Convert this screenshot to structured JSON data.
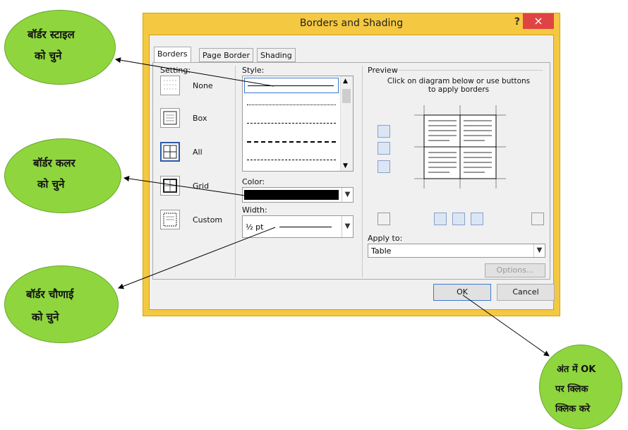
{
  "dialog": {
    "title": "Borders and Shading",
    "help_label": "?",
    "close_label": "×",
    "tabs": [
      {
        "label": "Borders"
      },
      {
        "label": "Page Border"
      },
      {
        "label": "Shading"
      }
    ],
    "setting": {
      "label": "Setting:",
      "items": [
        {
          "label": "None"
        },
        {
          "label": "Box"
        },
        {
          "label": "All"
        },
        {
          "label": "Grid"
        },
        {
          "label": "Custom"
        }
      ],
      "selected": "All"
    },
    "style": {
      "label": "Style:"
    },
    "color": {
      "label": "Color:",
      "value": "#000000"
    },
    "width": {
      "label": "Width:",
      "value": "½ pt"
    },
    "preview": {
      "label": "Preview",
      "instructions": "Click on diagram below or use buttons to apply borders"
    },
    "apply_to": {
      "label": "Apply to:",
      "value": "Table"
    },
    "options_label": "Options...",
    "ok_label": "OK",
    "cancel_label": "Cancel"
  },
  "callouts": {
    "style": {
      "line1": "बॉर्डर स्टाइल",
      "line2": "को चुने"
    },
    "color": {
      "line1": "बॉर्डर कलर",
      "line2": "को चुने"
    },
    "width": {
      "line1": "बॉर्डर चौणाई",
      "line2": "को चुने"
    },
    "ok": {
      "line1": "अंत में OK",
      "line2": "पर क्लिक",
      "line3": "क्लिक करे"
    }
  },
  "colors": {
    "window_frame": "#f5c842",
    "close_button": "#e04343",
    "callout_fill": "#8fd63e"
  }
}
